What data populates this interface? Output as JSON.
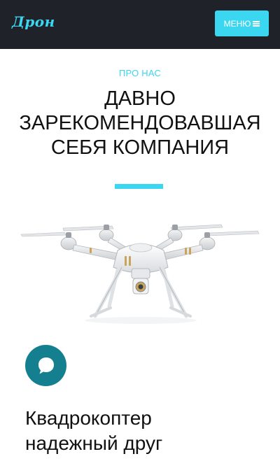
{
  "header": {
    "logo": "Дрон",
    "menu_label": "МЕНЮ",
    "menu_icon": "hamburger-icon",
    "bg_color": "#1f2228",
    "accent_color": "#3bd6f0"
  },
  "about": {
    "eyebrow": "ПРО НАС",
    "heading_lines": [
      "ДАВНО",
      "ЗАРЕКОМЕНДОВАВШАЯ",
      "СЕБЯ КОМПАНИЯ"
    ],
    "image": "drone-image",
    "badge_icon": "chat-bubble-icon",
    "badge_color": "#14808f",
    "subheading_lines": [
      "Квадрокоптер",
      "надежный друг"
    ]
  }
}
